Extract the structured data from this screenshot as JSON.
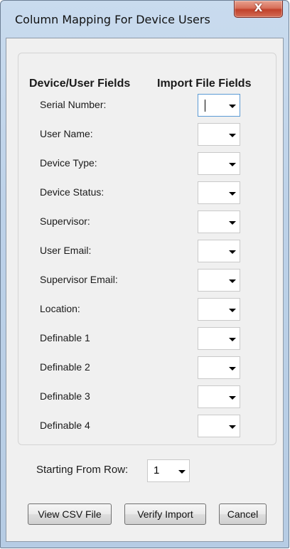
{
  "window": {
    "title": "Column Mapping For Device Users",
    "close_glyph": "X"
  },
  "mapping": {
    "header_left": "Device/User Fields",
    "header_right": "Import File Fields",
    "rows": [
      {
        "label": "Serial Number:",
        "value": ""
      },
      {
        "label": "User Name:",
        "value": ""
      },
      {
        "label": "Device Type:",
        "value": ""
      },
      {
        "label": "Device Status:",
        "value": ""
      },
      {
        "label": "Supervisor:",
        "value": ""
      },
      {
        "label": "User Email:",
        "value": ""
      },
      {
        "label": "Supervisor Email:",
        "value": ""
      },
      {
        "label": "Location:",
        "value": ""
      },
      {
        "label": "Definable 1",
        "value": ""
      },
      {
        "label": "Definable 2",
        "value": ""
      },
      {
        "label": "Definable 3",
        "value": ""
      },
      {
        "label": "Definable 4",
        "value": ""
      }
    ]
  },
  "starting_row": {
    "label": "Starting From Row:",
    "value": "1"
  },
  "buttons": {
    "view_csv": "View CSV File",
    "verify_import": "Verify Import",
    "cancel": "Cancel"
  },
  "icons": {
    "close": "close-icon",
    "dropdown": "chevron-down-icon"
  },
  "colors": {
    "close_button": "#c1412b",
    "titlebar": "#c9dbee",
    "client_bg": "#f0f0f0",
    "focus_border": "#5b9bd5"
  }
}
